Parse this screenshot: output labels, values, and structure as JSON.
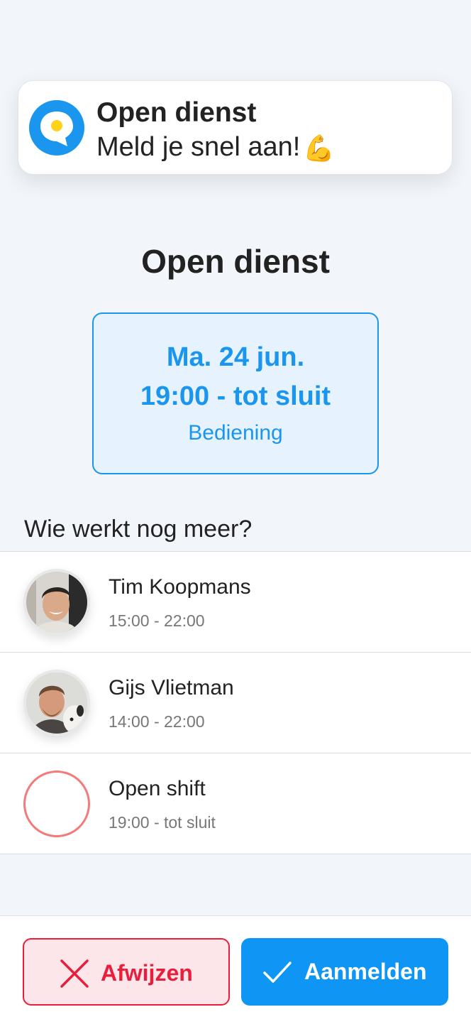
{
  "notification": {
    "title": "Open dienst",
    "message": "Meld je snel aan!",
    "emoji": "💪",
    "logo_icon": "speech-bubble-logo-icon",
    "accent_color": "#1a96ee"
  },
  "page": {
    "title": "Open dienst"
  },
  "shift": {
    "date": "Ma. 24 jun.",
    "time": "19:00 - tot sluit",
    "role": "Bediening",
    "accent_color": "#1a96ee"
  },
  "colleagues": {
    "heading": "Wie werkt nog meer?",
    "items": [
      {
        "name": "Tim Koopmans",
        "time": "15:00 - 22:00",
        "avatar": "photo"
      },
      {
        "name": "Gijs Vlietman",
        "time": "14:00 - 22:00",
        "avatar": "photo"
      },
      {
        "name": "Open shift",
        "time": "19:00 - tot sluit",
        "avatar": "open-slot"
      }
    ]
  },
  "actions": {
    "reject_label": "Afwijzen",
    "reject_icon": "close-x-icon",
    "reject_color": "#e81e3c",
    "accept_label": "Aanmelden",
    "accept_icon": "checkmark-icon",
    "accept_color": "#0f96f5"
  }
}
